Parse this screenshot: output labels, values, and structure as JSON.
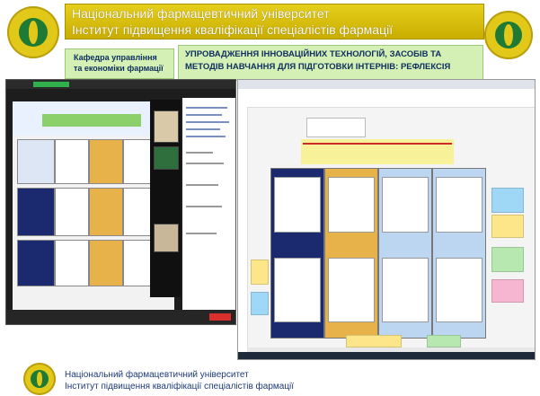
{
  "header": {
    "title_line1": "Національний фармацевтичний університет",
    "title_line2": "Інститут підвищення кваліфікації спеціалістів фармації",
    "band_color": "#d6bc0a"
  },
  "department": {
    "line1": "Кафедра управління",
    "line2": "та економіки фармації"
  },
  "topic": {
    "line1": "УПРОВАДЖЕННЯ ІННОВАЦІЙНИХ ТЕХНОЛОГІЙ, ЗАСОБІВ ТА",
    "line2": "МЕТОДІВ НАВЧАННЯ ДЛЯ ПІДГОТОВКИ ІНТЕРНІВ: РЕФЛЕКСІЯ"
  },
  "footer": {
    "line1": "Національний фармацевтичний університет",
    "line2": "Інститут підвищення кваліфікації спеціалістів фармації"
  },
  "icons": {
    "logo": "university-emblem-icon"
  },
  "colors": {
    "accent_green": "#d4f0b4",
    "text_blue": "#103060"
  }
}
